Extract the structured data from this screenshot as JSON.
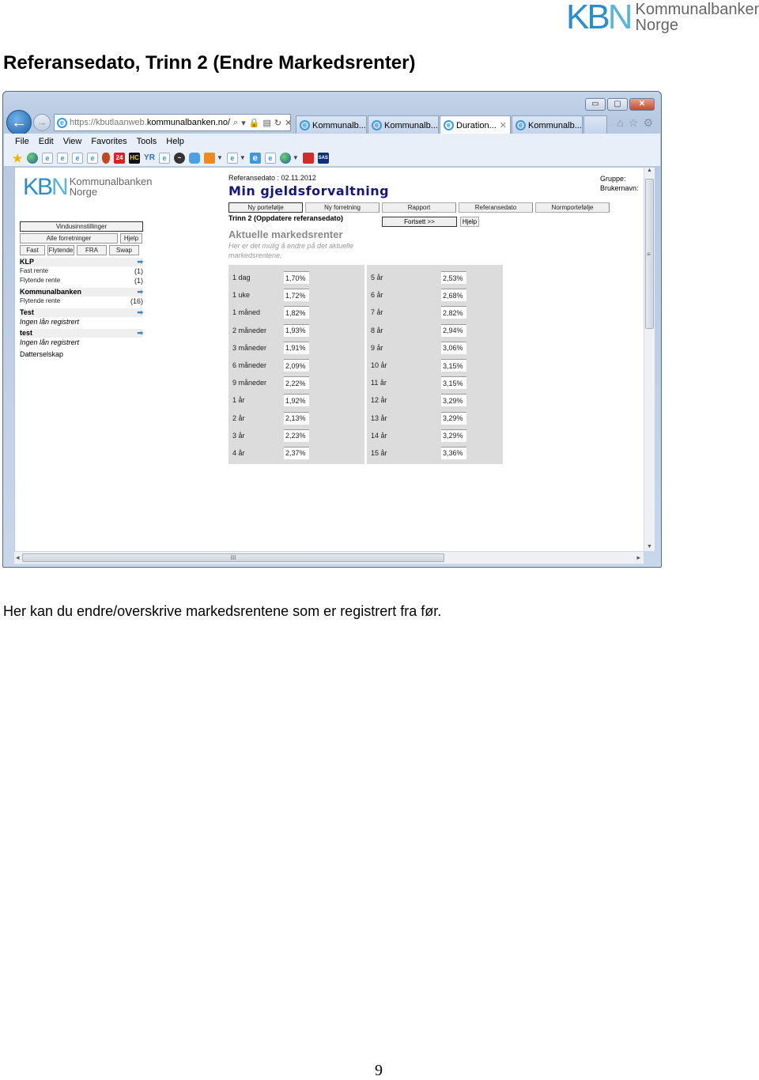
{
  "document": {
    "logo": {
      "letters": [
        "K",
        "B",
        "N"
      ],
      "line1": "Kommunalbanken",
      "line2": "Norge"
    },
    "title": "Referansedato, Trinn 2 (Endre Markedsrenter)",
    "caption": "Her kan du endre/overskrive markedsrentene som er registrert fra før.",
    "page_number": "9"
  },
  "browser": {
    "window_controls": {
      "minimize": "▭",
      "maximize": "▢",
      "close": "✕"
    },
    "back_icon": "←",
    "forward_icon": "→",
    "address": {
      "url_prefix": "https://kbutlaanweb.",
      "url_domain": "kommunalbanken.no/",
      "search_icon": "⌕",
      "dropdown_icon": "▾",
      "lock_icon": "🔒",
      "compat_icon": "▤",
      "refresh_icon": "↻",
      "stop_icon": "✕"
    },
    "tabs": [
      {
        "label": "Kommunalb...",
        "active": false
      },
      {
        "label": "Kommunalb...",
        "active": false
      },
      {
        "label": "Duration...",
        "active": true,
        "close": "✕"
      },
      {
        "label": "Kommunalb...",
        "active": false
      }
    ],
    "toolbar_icons": {
      "home": "⌂",
      "favorites": "☆",
      "settings": "⚙"
    },
    "menu": [
      "File",
      "Edit",
      "View",
      "Favorites",
      "Tools",
      "Help"
    ],
    "favorites_bar": [
      {
        "name": "add-favorite",
        "glyph": "★"
      },
      {
        "name": "globe",
        "glyph": ""
      },
      {
        "name": "ie-page",
        "glyph": "e"
      },
      {
        "name": "ie-page",
        "glyph": "e"
      },
      {
        "name": "ie-page",
        "glyph": "e"
      },
      {
        "name": "ie-page",
        "glyph": "e"
      },
      {
        "name": "shield",
        "glyph": ""
      },
      {
        "name": "24",
        "glyph": "24"
      },
      {
        "name": "hc",
        "glyph": "HC"
      },
      {
        "name": "yr",
        "glyph": "YR"
      },
      {
        "name": "ie-page",
        "glyph": "e"
      },
      {
        "name": "dark-circle",
        "glyph": "~"
      },
      {
        "name": "blue-app",
        "glyph": ""
      },
      {
        "name": "orange-bulb",
        "glyph": ""
      },
      {
        "name": "ie-page",
        "glyph": "e"
      },
      {
        "name": "ie-blue",
        "glyph": "e"
      },
      {
        "name": "ie-page",
        "glyph": "e"
      },
      {
        "name": "globe",
        "glyph": ""
      },
      {
        "name": "nsb",
        "glyph": ""
      },
      {
        "name": "sas",
        "glyph": "SAS"
      }
    ],
    "scroll": {
      "up": "▲",
      "down": "▼",
      "left": "◂",
      "right": "▸",
      "grip_v": "≡",
      "grip_h": "III"
    }
  },
  "page": {
    "logo": {
      "letters": [
        "K",
        "B",
        "N"
      ],
      "line1": "Kommunalbanken",
      "line2": "Norge"
    },
    "sidebar": {
      "window_settings": "Vindusinnstillinger",
      "all_deals": "Alle forretninger",
      "help": "Hjelp",
      "filters": [
        "Fast",
        "Flytende",
        "FRA",
        "Swap"
      ],
      "arrow": "➡",
      "groups": [
        {
          "name": "KLP",
          "items": [
            {
              "label": "Fast rente",
              "count": "(1)"
            },
            {
              "label": "Flytende rente",
              "count": "(1)"
            }
          ]
        },
        {
          "name": "Kommunalbanken",
          "items": [
            {
              "label": "Flytende rente",
              "count": "(16)"
            }
          ]
        },
        {
          "name": "Test",
          "empty": "Ingen lån registrert"
        },
        {
          "name": "test",
          "empty": "Ingen lån registrert"
        }
      ],
      "subsidiary": "Datterselskap"
    },
    "reference_date": "Referansedato : 02.11.2012",
    "app_title": "Min gjeldsforvaltning",
    "user_info": {
      "group": "Gruppe:",
      "username": "Brukernavn:"
    },
    "nav_tabs": [
      "Ny portefølje",
      "Ny forretning",
      "Rapport",
      "Referansedato",
      "Normportefølje"
    ],
    "step_title": "Trinn 2 (Oppdatere referansedato)",
    "continue_button": "Fortsett >>",
    "help_button": "Hjelp",
    "section_title": "Aktuelle markedsrenter",
    "section_desc": "Her er det mulig å endre på det aktuelle markedsrentene.",
    "rates_left": [
      {
        "label": "1 dag",
        "value": "1,70%"
      },
      {
        "label": "1 uke",
        "value": "1,72%"
      },
      {
        "label": "1 måned",
        "value": "1,82%"
      },
      {
        "label": "2 måneder",
        "value": "1,93%"
      },
      {
        "label": "3 måneder",
        "value": "1,91%"
      },
      {
        "label": "6 måneder",
        "value": "2,09%"
      },
      {
        "label": "9 måneder",
        "value": "2,22%"
      },
      {
        "label": "1 år",
        "value": "1,92%"
      },
      {
        "label": "2 år",
        "value": "2,13%"
      },
      {
        "label": "3 år",
        "value": "2,23%"
      },
      {
        "label": "4 år",
        "value": "2,37%"
      }
    ],
    "rates_right": [
      {
        "label": "5 år",
        "value": "2,53%"
      },
      {
        "label": "6 år",
        "value": "2,68%"
      },
      {
        "label": "7 år",
        "value": "2,82%"
      },
      {
        "label": "8 år",
        "value": "2,94%"
      },
      {
        "label": "9 år",
        "value": "3,06%"
      },
      {
        "label": "10 år",
        "value": "3,15%"
      },
      {
        "label": "11 år",
        "value": "3,15%"
      },
      {
        "label": "12 år",
        "value": "3,29%"
      },
      {
        "label": "13 år",
        "value": "3,29%"
      },
      {
        "label": "14 år",
        "value": "3,29%"
      },
      {
        "label": "15 år",
        "value": "3,36%"
      }
    ]
  }
}
